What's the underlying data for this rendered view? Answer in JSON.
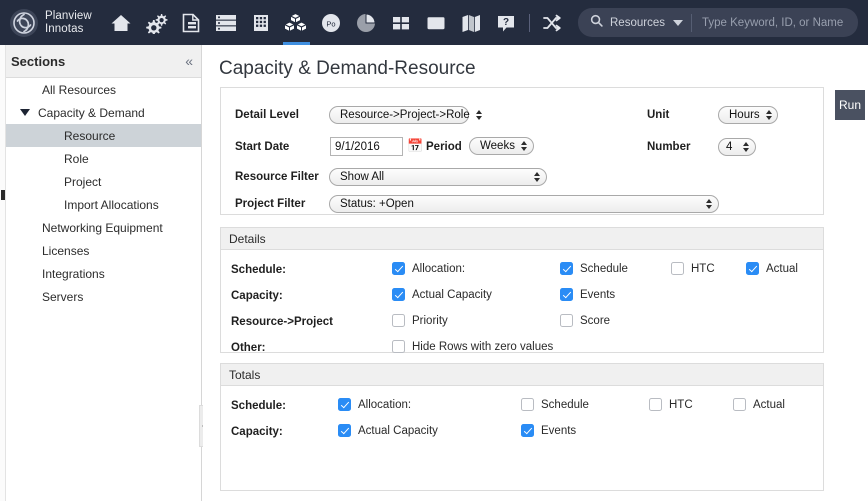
{
  "topnav": {
    "brand": {
      "line1": "Planview",
      "line2": "Innotas",
      "logo_icon": "planview-swirl-logo"
    },
    "items": [
      {
        "name": "home",
        "icon": "home-icon",
        "active": false
      },
      {
        "name": "admin",
        "icon": "gears-icon",
        "active": false
      },
      {
        "name": "documents",
        "icon": "document-icon",
        "active": false
      },
      {
        "name": "projects",
        "icon": "list-rows-icon",
        "active": false
      },
      {
        "name": "portfolio",
        "icon": "grid-building-icon",
        "active": false
      },
      {
        "name": "resources",
        "icon": "cubes-icon",
        "active": true
      },
      {
        "name": "po",
        "icon": "po-circle-icon",
        "active": false
      },
      {
        "name": "reports",
        "icon": "pie-chart-icon",
        "active": false
      },
      {
        "name": "dashboards",
        "icon": "four-squares-icon",
        "active": false
      },
      {
        "name": "inbox",
        "icon": "inbox-icon",
        "active": false
      },
      {
        "name": "roadmap",
        "icon": "map-icon",
        "active": false
      },
      {
        "name": "help",
        "icon": "help-icon",
        "active": false
      },
      {
        "name": "switch",
        "icon": "shuffle-icon",
        "active": false
      }
    ],
    "search": {
      "icon": "search-icon",
      "category": "Resources",
      "caret_icon": "chevron-down-icon",
      "placeholder": "Type Keyword, ID, or Name",
      "value": ""
    }
  },
  "sidebar": {
    "title": "Sections",
    "collapse_icon": "double-chevron-left-icon",
    "handle_icon": "chevron-left-icon",
    "items": [
      {
        "label": "All Resources",
        "level": 1,
        "caret": false,
        "selected": false
      },
      {
        "label": "Capacity & Demand",
        "level": 1,
        "caret": true,
        "selected": false
      },
      {
        "label": "Resource",
        "level": 2,
        "caret": false,
        "selected": true
      },
      {
        "label": "Role",
        "level": 2,
        "caret": false,
        "selected": false
      },
      {
        "label": "Project",
        "level": 2,
        "caret": false,
        "selected": false
      },
      {
        "label": "Import Allocations",
        "level": 2,
        "caret": false,
        "selected": false
      },
      {
        "label": "Networking Equipment",
        "level": 1,
        "caret": false,
        "selected": false
      },
      {
        "label": "Licenses",
        "level": 1,
        "caret": false,
        "selected": false
      },
      {
        "label": "Integrations",
        "level": 1,
        "caret": false,
        "selected": false
      },
      {
        "label": "Servers",
        "level": 1,
        "caret": false,
        "selected": false
      }
    ]
  },
  "main": {
    "page_title": "Capacity & Demand-Resource",
    "run_label": "Run",
    "criteria": {
      "detail_level_label": "Detail Level",
      "detail_level_value": "Resource->Project->Role",
      "start_date_label": "Start Date",
      "start_date_value": "9/1/2016",
      "calendar_icon": "calendar-icon",
      "period_label": "Period",
      "period_value": "Weeks",
      "resource_filter_label": "Resource Filter",
      "resource_filter_value": "Show All",
      "project_filter_label": "Project Filter",
      "project_filter_value": "Status: +Open",
      "unit_label": "Unit",
      "unit_value": "Hours",
      "number_label": "Number",
      "number_value": "4"
    },
    "details": {
      "title": "Details",
      "rows": [
        {
          "label": "Schedule:",
          "checks": [
            {
              "label": "Allocation:",
              "checked": true
            },
            {
              "label": "Schedule",
              "checked": true
            },
            {
              "label": "HTC",
              "checked": false
            },
            {
              "label": "Actual",
              "checked": true
            }
          ]
        },
        {
          "label": "Capacity:",
          "checks": [
            {
              "label": "Actual Capacity",
              "checked": true
            },
            {
              "label": "Events",
              "checked": true
            }
          ]
        },
        {
          "label": "Resource->Project",
          "checks": [
            {
              "label": "Priority",
              "checked": false
            },
            {
              "label": "Score",
              "checked": false
            }
          ]
        },
        {
          "label": "Other:",
          "checks": [
            {
              "label": "Hide Rows with zero values",
              "checked": false
            }
          ]
        }
      ]
    },
    "totals": {
      "title": "Totals",
      "rows": [
        {
          "label": "Schedule:",
          "checks": [
            {
              "label": "Allocation:",
              "checked": true
            },
            {
              "label": "Schedule",
              "checked": false
            },
            {
              "label": "HTC",
              "checked": false
            },
            {
              "label": "Actual",
              "checked": false
            }
          ]
        },
        {
          "label": "Capacity:",
          "checks": [
            {
              "label": "Actual Capacity",
              "checked": true
            },
            {
              "label": "Events",
              "checked": true
            }
          ]
        }
      ]
    }
  },
  "colors": {
    "navbar": "#242c3e",
    "accent": "#3f8fe0",
    "checkbox_on": "#2a8cf5",
    "selected_row": "#cdd3d8",
    "run_button": "#4a5161"
  }
}
